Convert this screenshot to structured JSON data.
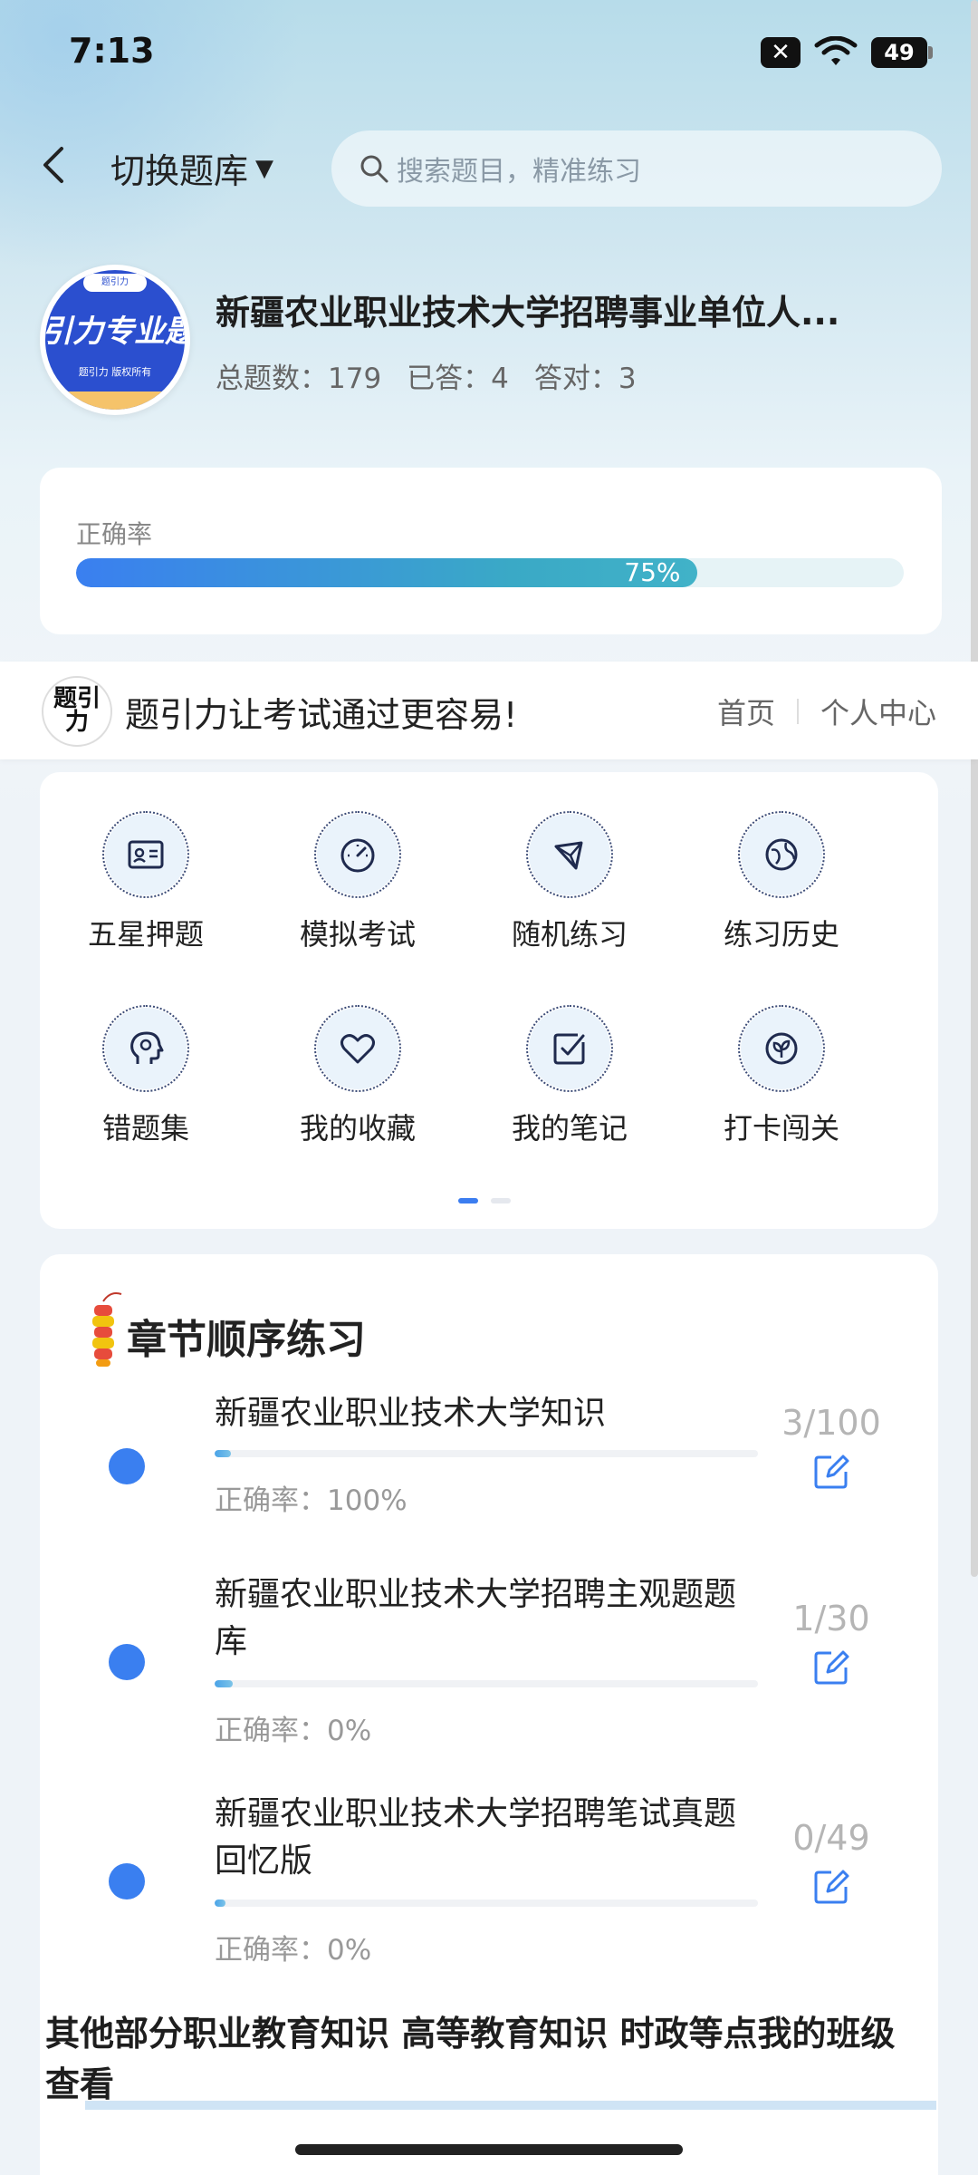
{
  "status_bar": {
    "time": "7:13",
    "battery": "49"
  },
  "topbar": {
    "switch_label": "切换题库",
    "search_placeholder": "搜索题目，精准练习"
  },
  "bank": {
    "logo_text": "引力专业题",
    "logo_sub": "题引力 版权所有",
    "logo_top": "题引力",
    "title": "新疆农业职业技术大学招聘事业单位人...",
    "stats": {
      "total_label": "总题数：",
      "total": "179",
      "answered_label": "已答：",
      "answered": "4",
      "correct_label": "答对：",
      "correct": "3"
    }
  },
  "accuracy": {
    "label": "正确率",
    "percent_text": "75%",
    "value": 0.75
  },
  "brand": {
    "logo_text": "题引力",
    "slogan": "题引力让考试通过更容易!",
    "nav": [
      "首页",
      "个人中心"
    ]
  },
  "grid": {
    "items": [
      {
        "label": "五星押题",
        "icon": "id-card-icon"
      },
      {
        "label": "模拟考试",
        "icon": "gauge-icon"
      },
      {
        "label": "随机练习",
        "icon": "random-icon"
      },
      {
        "label": "练习历史",
        "icon": "globe-icon"
      },
      {
        "label": "错题集",
        "icon": "head-icon"
      },
      {
        "label": "我的收藏",
        "icon": "heart-icon"
      },
      {
        "label": "我的笔记",
        "icon": "note-check-icon"
      },
      {
        "label": "打卡闯关",
        "icon": "leaf-icon"
      }
    ],
    "page": 1,
    "pages": 2
  },
  "chapters": {
    "title": "章节顺序练习",
    "items": [
      {
        "name": "新疆农业职业技术大学知识",
        "rate": "正确率：100%",
        "count": "3/100",
        "progress": 0.03
      },
      {
        "name": "新疆农业职业技术大学招聘主观题题库",
        "rate": "正确率：0%",
        "count": "1/30",
        "progress": 0.033
      },
      {
        "name": "新疆农业职业技术大学招聘笔试真题回忆版",
        "rate": "正确率：0%",
        "count": "0/49",
        "progress": 0.0
      }
    ],
    "other_text": "其他部分职业教育知识 高等教育知识 时政等点我的班级查看"
  },
  "colors": {
    "accent": "#3a7ff0",
    "teal": "#41b2c8"
  }
}
